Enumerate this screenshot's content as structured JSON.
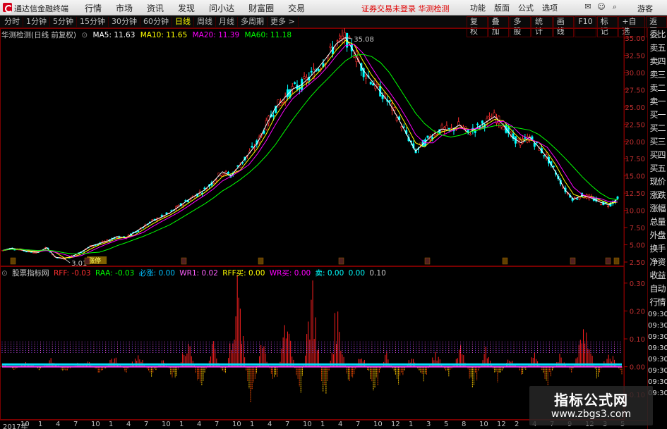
{
  "titlebar": {
    "app_name": "通达信金融终端",
    "menu": [
      "行情",
      "市场",
      "资讯",
      "发现",
      "问小达",
      "财富圈",
      "交易"
    ],
    "status": "证券交易未登录  华测检测",
    "right_menu": [
      "功能",
      "版面",
      "公式",
      "选项"
    ],
    "guest": "游客"
  },
  "tabbar": {
    "tabs": [
      "分时",
      "1分钟",
      "5分钟",
      "15分钟",
      "30分钟",
      "60分钟",
      "日线",
      "周线",
      "月线",
      "多周期",
      "更多 >"
    ],
    "active_index": 6,
    "tools": [
      "复权",
      "叠加",
      "多股",
      "统计",
      "画线",
      "F10",
      "标记",
      "+自选",
      "返回"
    ]
  },
  "chart_head": {
    "title": "华测检测(日线 前复权)",
    "ma5": "MA5: 11.63",
    "ma10": "MA10: 11.65",
    "ma20": "MA20: 11.39",
    "ma60": "MA60: 11.18",
    "colors": {
      "ma5": "#ffffff",
      "ma10": "#ffff00",
      "ma20": "#ff00ff",
      "ma60": "#00ff00"
    }
  },
  "ind_head": {
    "name": "股票指标网",
    "rff": "RFF: -0.03",
    "raa": "RAA: -0.03",
    "bx": "必涨: 0.00",
    "wr1": "WR1: 0.02",
    "rffbuy": "RFF买: 0.00",
    "wrbuy": "WR买: 0.00",
    "sell": "卖: 0.00",
    "val1": "0.00",
    "val2": "0.10"
  },
  "price_axis": [
    "35.00",
    "32.50",
    "30.00",
    "27.50",
    "25.00",
    "22.50",
    "20.00",
    "17.50",
    "15.00",
    "12.50",
    "10.00",
    "7.50",
    "5.00",
    "2.50"
  ],
  "ind_axis": [
    "0.30",
    "0.20",
    "0.10",
    "0.00",
    "-0.10"
  ],
  "annotations": {
    "high": "35.08",
    "low": "3.01",
    "low_tag": "涨停"
  },
  "right_panel": [
    "委比",
    "卖五",
    "卖四",
    "卖三",
    "卖二",
    "卖一",
    "买一",
    "买二",
    "买三",
    "买四",
    "买五",
    "现价",
    "涨跌",
    "涨幅",
    "总量",
    "外盘",
    "换手",
    "净资",
    "收益",
    "自动",
    "行情"
  ],
  "right_times": [
    "09:30",
    "09:30",
    "09:30",
    "09:30",
    "09:30",
    "09:30",
    "09:30",
    "09:30"
  ],
  "x_axis": [
    "2017年",
    "10",
    "1",
    "4",
    "7",
    "10",
    "1",
    "4",
    "7",
    "10",
    "1",
    "4",
    "7",
    "10",
    "1",
    "4",
    "7",
    "10",
    "1",
    "4",
    "7",
    "10",
    "12",
    "1",
    "3",
    "5",
    "8",
    "10",
    "12",
    "2",
    "4",
    "7",
    "9",
    "12",
    "3",
    "5"
  ],
  "watermark": {
    "title": "指标公式网",
    "url": "www.zbgs3.com"
  },
  "chart_data": [
    {
      "type": "line",
      "title": "华测检测(日线 前复权)",
      "ylim": [
        2.5,
        35
      ],
      "series": [
        {
          "name": "收盘",
          "values": [
            4.2,
            4.5,
            4.3,
            4.0,
            3.9,
            4.6,
            3.2,
            3.01,
            3.4,
            4.0,
            4.8,
            5.2,
            5.6,
            6.2,
            6.0,
            6.8,
            7.6,
            8.4,
            9.0,
            9.6,
            10.5,
            11.4,
            12.2,
            13.0,
            14.2,
            15.6,
            15.0,
            16.6,
            18.2,
            19.8,
            22.4,
            24.8,
            26.2,
            27.6,
            28.2,
            29.4,
            30.8,
            32.4,
            34.2,
            35.08,
            33.0,
            30.4,
            28.8,
            27.2,
            25.6,
            23.4,
            21.0,
            18.6,
            19.8,
            21.0,
            21.8,
            21.6,
            22.4,
            21.2,
            22.0,
            22.8,
            23.6,
            22.4,
            20.6,
            19.8,
            20.6,
            19.2,
            17.6,
            15.4,
            13.0,
            11.6,
            12.2,
            11.8,
            11.2,
            10.8,
            11.63
          ]
        }
      ]
    },
    {
      "type": "bar",
      "title": "股票指标网",
      "ylim": [
        -0.15,
        0.33
      ],
      "series": [
        {
          "name": "RFF",
          "values": [
            0.01,
            -0.01,
            0.02,
            -0.01,
            0.03,
            -0.02,
            0.01,
            0.02,
            -0.03,
            0.04,
            -0.02,
            0.05,
            -0.04,
            0.03,
            -0.06,
            0.12,
            -0.1,
            0.08,
            -0.05,
            0.28,
            -0.15,
            0.1,
            -0.08,
            0.18,
            -0.12,
            0.3,
            -0.14,
            0.2,
            -0.08,
            0.06,
            -0.1,
            0.05,
            -0.06,
            0.04,
            -0.05,
            0.06,
            -0.04,
            0.07,
            -0.08,
            0.06,
            -0.05,
            0.04,
            -0.03,
            0.05,
            -0.06,
            0.04,
            -0.02,
            0.15,
            -0.04,
            0.06,
            -0.03
          ]
        }
      ]
    }
  ]
}
